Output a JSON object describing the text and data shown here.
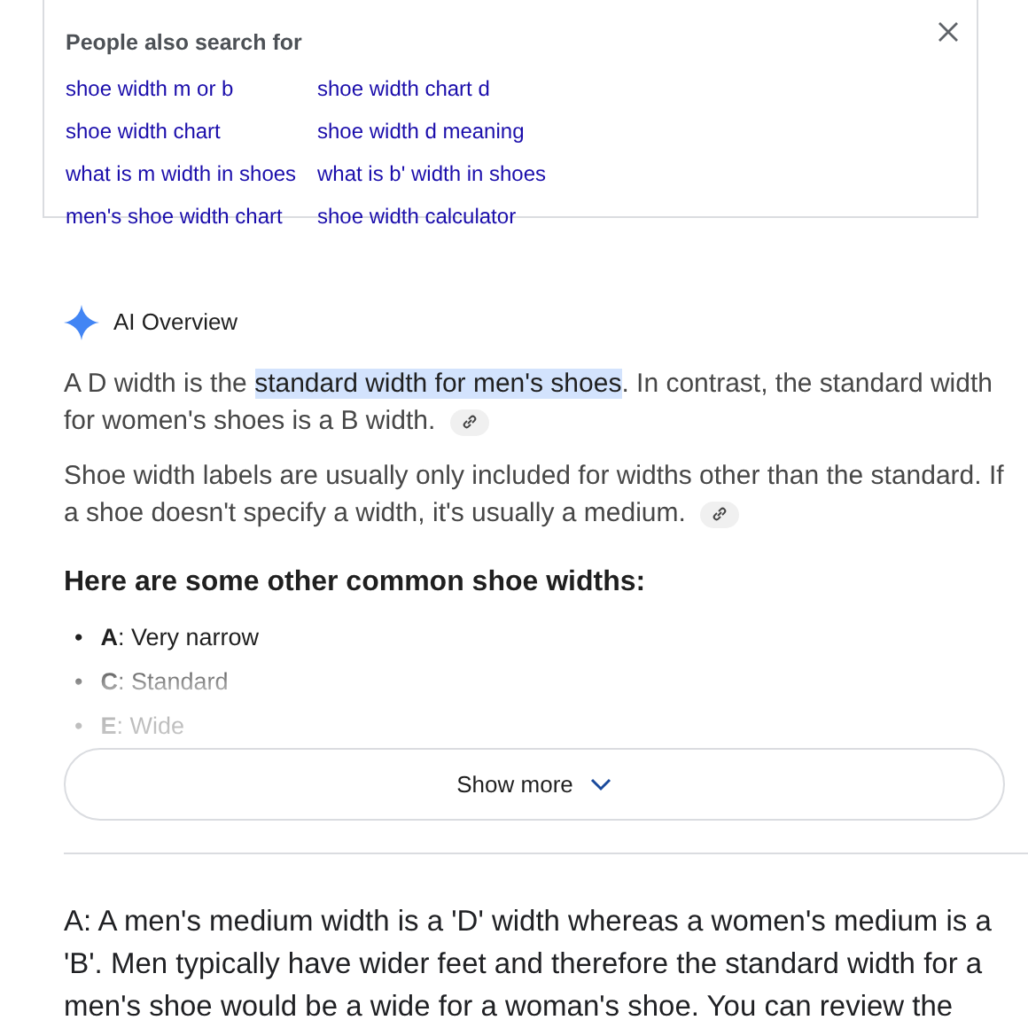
{
  "related_searches": {
    "title": "People also search for",
    "columns": [
      [
        "shoe width m or b",
        "shoe width chart",
        "what is m width in shoes",
        "men's shoe width chart"
      ],
      [
        "shoe width chart d",
        "shoe width d meaning",
        "what is b' width in shoes",
        "shoe width calculator"
      ]
    ]
  },
  "ai_overview": {
    "title": "AI Overview",
    "paragraphs": [
      [
        {
          "text": "A D width is the ",
          "highlighted": false
        },
        {
          "text": "standard width for men's shoes",
          "highlighted": true
        },
        {
          "text": ". In contrast, the standard width for women's shoes is a B width.",
          "highlighted": false
        }
      ],
      [
        {
          "text": "Shoe width labels are usually only included for widths other than the standard. If a shoe doesn't specify a width, it's usually a medium.",
          "highlighted": false
        }
      ]
    ],
    "heading": "Here are some other common shoe widths:",
    "items": [
      {
        "marker": "•",
        "label": "A",
        "text": ": Very narrow"
      },
      {
        "marker": "•",
        "label": "C",
        "text": ": Standard"
      },
      {
        "marker": "•",
        "label": "E",
        "text": ": Wide"
      }
    ],
    "show_more": "Show more"
  },
  "answer": "A: A men's medium width is a 'D' width whereas a women's medium is a 'B'. Men typically have wider feet and therefore the standard width for a men's shoe would be a wide for a woman's shoe. You can review the"
}
